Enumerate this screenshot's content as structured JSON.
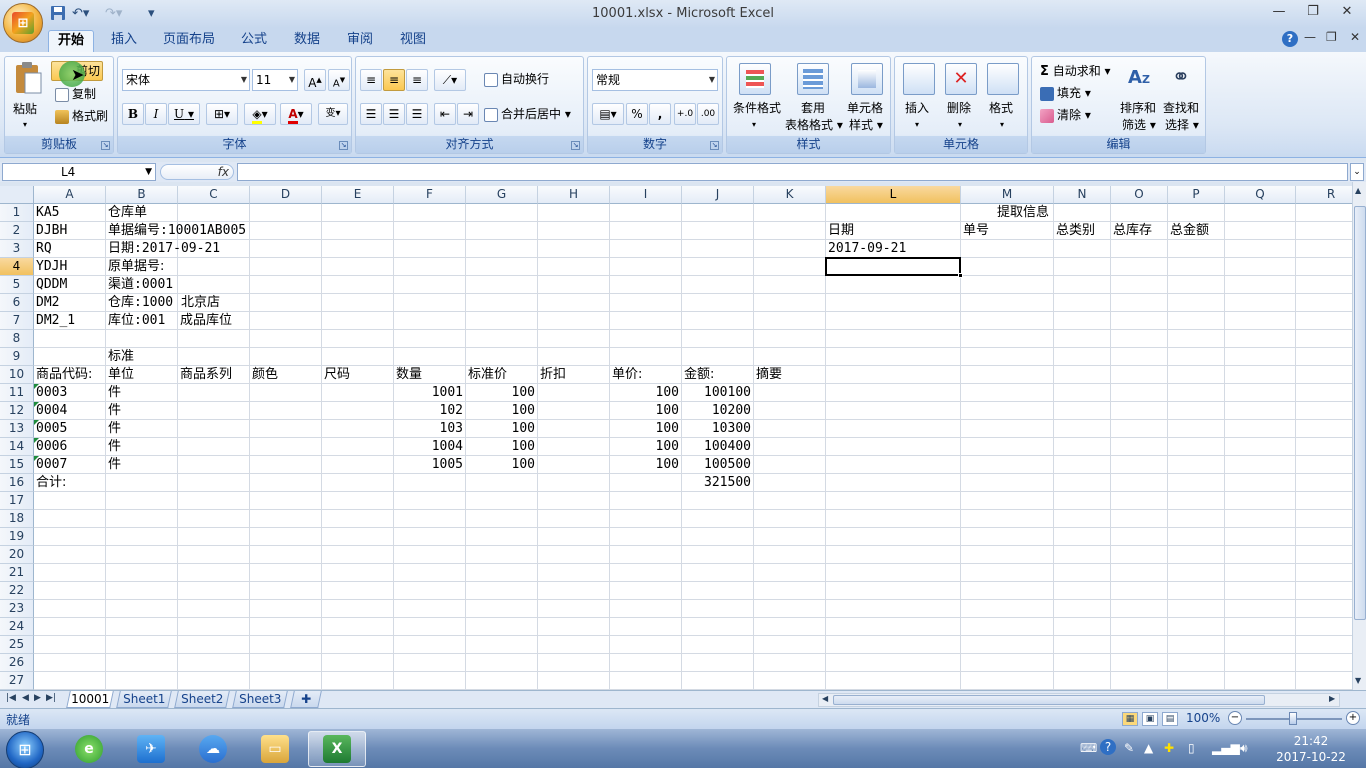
{
  "window": {
    "title": "10001.xlsx - Microsoft Excel"
  },
  "office_button": {
    "label": "Office"
  },
  "ribbon_tabs": [
    "开始",
    "插入",
    "页面布局",
    "公式",
    "数据",
    "审阅",
    "视图"
  ],
  "clipboard": {
    "paste": "粘贴",
    "cut": "剪切",
    "copy": "复制",
    "format_painter": "格式刷",
    "group": "剪贴板"
  },
  "font": {
    "name": "宋体",
    "size": "11",
    "bold": "B",
    "italic": "I",
    "underline": "U",
    "group": "字体"
  },
  "alignment": {
    "wrap_text": "自动换行",
    "merge_center": "合并后居中",
    "group": "对齐方式"
  },
  "number": {
    "format": "常规",
    "percent": "%",
    "comma": ",",
    "group": "数字"
  },
  "styles": {
    "conditional": "条件格式",
    "table_1": "套用",
    "table_2": "表格格式",
    "cell_1": "单元格",
    "cell_2": "样式",
    "group": "样式"
  },
  "cells": {
    "insert": "插入",
    "delete": "删除",
    "format": "格式",
    "group": "单元格"
  },
  "editing": {
    "autosum": "自动求和",
    "fill": "填充",
    "clear": "清除",
    "sort_1": "排序和",
    "sort_2": "筛选",
    "find_1": "查找和",
    "find_2": "选择",
    "group": "编辑"
  },
  "formula_bar": {
    "name_box": "L4",
    "fx": "fx",
    "content": ""
  },
  "columns": [
    "A",
    "B",
    "C",
    "D",
    "E",
    "F",
    "G",
    "H",
    "I",
    "J",
    "K",
    "L",
    "M",
    "N",
    "O",
    "P",
    "Q",
    "R"
  ],
  "selected_column": "L",
  "rows": [
    "1",
    "2",
    "3",
    "4",
    "5",
    "6",
    "7",
    "8",
    "9",
    "10",
    "11",
    "12",
    "13",
    "14",
    "15",
    "16",
    "17",
    "18",
    "19",
    "20",
    "21",
    "22",
    "23",
    "24",
    "25",
    "26",
    "27"
  ],
  "selected_row": "4",
  "cell_values": {
    "A1": "KA5",
    "B1": "仓库单",
    "A2": "DJBH",
    "B2": "单据编号:10001AB005",
    "A3": "RQ",
    "B3": "日期:2017-09-21",
    "A4": "YDJH",
    "B4": "原单据号:",
    "A5": "QDDM",
    "B5": "渠道:0001",
    "A6": "DM2",
    "B6": "仓库:1000 北京店",
    "A7": "DM2_1",
    "B7": "库位:001",
    "C7": "成品库位",
    "B9": "标准",
    "A10": "商品代码:",
    "B10": "单位",
    "C10": "商品系列",
    "D10": "颜色",
    "E10": "尺码",
    "F10": "数量",
    "G10": "标准价",
    "H10": "折扣",
    "I10": "单价:",
    "J10": "金额:",
    "K10": "摘要",
    "A11": "0003",
    "B11": "件",
    "F11": "1001",
    "G11": "100",
    "I11": "100",
    "J11": "100100",
    "A12": "0004",
    "B12": "件",
    "F12": "102",
    "G12": "100",
    "I12": "100",
    "J12": "10200",
    "A13": "0005",
    "B13": "件",
    "F13": "103",
    "G13": "100",
    "I13": "100",
    "J13": "10300",
    "A14": "0006",
    "B14": "件",
    "F14": "1004",
    "G14": "100",
    "I14": "100",
    "J14": "100400",
    "A15": "0007",
    "B15": "件",
    "F15": "1005",
    "G15": "100",
    "I15": "100",
    "J15": "100500",
    "A16": "合计:",
    "J16": "321500",
    "M1": "提取信息",
    "L2": "日期",
    "M2": "单号",
    "N2": "总类别",
    "O2": "总库存",
    "P2": "总金额",
    "L3": "2017-09-21"
  },
  "sheet_tabs": [
    "10001",
    "Sheet1",
    "Sheet2",
    "Sheet3"
  ],
  "active_sheet": "10001",
  "status": {
    "ready": "就绪",
    "zoom": "100%"
  },
  "taskbar": {
    "time": "21:42",
    "date": "2017-10-22"
  },
  "icons": [
    "save-icon",
    "undo-icon",
    "redo-icon",
    "help-icon",
    "paste-icon",
    "cut-icon",
    "copy-icon",
    "format-painter-icon",
    "sigma-icon",
    "sort-icon",
    "find-icon",
    "windows-start-icon"
  ]
}
